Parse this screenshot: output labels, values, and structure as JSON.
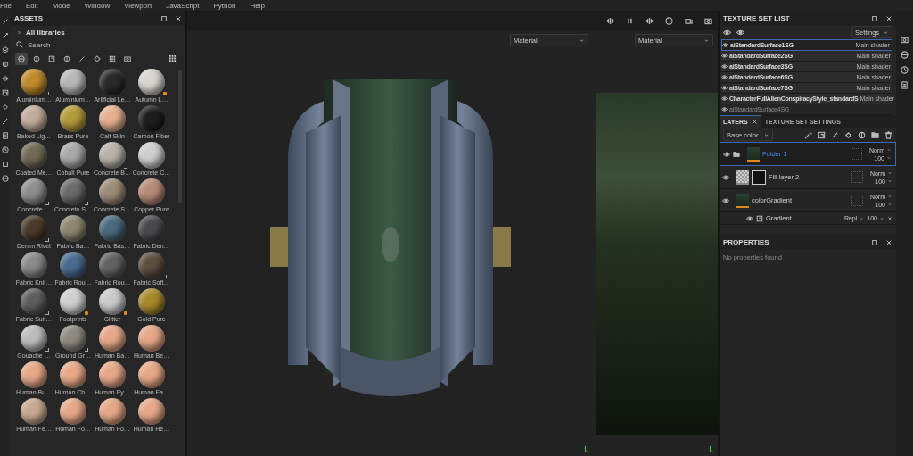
{
  "menu": [
    "File",
    "Edit",
    "Mode",
    "Window",
    "Viewport",
    "JavaScript",
    "Python",
    "Help"
  ],
  "assets": {
    "title": "ASSETS",
    "library": "All libraries",
    "search": {
      "placeholder": "Search"
    },
    "filters": [
      {
        "selected": true
      },
      {
        "selected": false
      },
      {
        "selected": false
      },
      {
        "selected": false
      },
      {
        "selected": false
      },
      {
        "selected": false
      },
      {
        "selected": false
      },
      {
        "selected": false
      }
    ],
    "materials": [
      {
        "name": "Aluminium…",
        "color": "#c08a2a",
        "kind": "procedural"
      },
      {
        "name": "Aluminium…",
        "color": "#b8b8b8",
        "kind": "basic"
      },
      {
        "name": "Artificial Le…",
        "color": "#2a2a2a",
        "kind": "basic"
      },
      {
        "name": "Autumn L…",
        "color": "#d8d4d0",
        "kind": "effect"
      },
      {
        "name": "Baked Lig…",
        "color": "#c2ad9a",
        "kind": "basic"
      },
      {
        "name": "Brass Pure",
        "color": "#b39a3a",
        "kind": "basic"
      },
      {
        "name": "Calf Skin",
        "color": "#e6b08f",
        "kind": "basic"
      },
      {
        "name": "Carbon Fiber",
        "color": "#1e1e1e",
        "kind": "basic"
      },
      {
        "name": "Coated Me…",
        "color": "#716a56",
        "kind": "basic"
      },
      {
        "name": "Cobalt Pure",
        "color": "#a8a8a8",
        "kind": "basic"
      },
      {
        "name": "Concrete B…",
        "color": "#b8b2a8",
        "kind": "procedural"
      },
      {
        "name": "Concrete C…",
        "color": "#cfcfcf",
        "kind": "basic"
      },
      {
        "name": "Concrete …",
        "color": "#8e8e8e",
        "kind": "procedural"
      },
      {
        "name": "Concrete S…",
        "color": "#6a6a6a",
        "kind": "procedural"
      },
      {
        "name": "Concrete S…",
        "color": "#9c8c78",
        "kind": "basic"
      },
      {
        "name": "Copper Pure",
        "color": "#b88a78",
        "kind": "basic"
      },
      {
        "name": "Denim Rivet",
        "color": "#4a3a2a",
        "kind": "procedural"
      },
      {
        "name": "Fabric Ba…",
        "color": "#8e8670",
        "kind": "basic"
      },
      {
        "name": "Fabric Bas…",
        "color": "#4a6a7e",
        "kind": "basic"
      },
      {
        "name": "Fabric Den…",
        "color": "#4a4a4e",
        "kind": "basic"
      },
      {
        "name": "Fabric Knit…",
        "color": "#8a8a8a",
        "kind": "basic"
      },
      {
        "name": "Fabric Rou…",
        "color": "#4a6a8e",
        "kind": "basic"
      },
      {
        "name": "Fabric Rou…",
        "color": "#626262",
        "kind": "basic"
      },
      {
        "name": "Fabric Soft…",
        "color": "#5e4e40",
        "kind": "procedural"
      },
      {
        "name": "Fabric Suit…",
        "color": "#5e5e5e",
        "kind": "procedural"
      },
      {
        "name": "Footprints",
        "color": "#d0d0d0",
        "kind": "effect"
      },
      {
        "name": "Glitter",
        "color": "#cacaca",
        "kind": "effect"
      },
      {
        "name": "Gold Pure",
        "color": "#a88a2a",
        "kind": "basic"
      },
      {
        "name": "Gouache …",
        "color": "#bcbcbc",
        "kind": "procedural"
      },
      {
        "name": "Ground Gr…",
        "color": "#8e8a80",
        "kind": "procedural"
      },
      {
        "name": "Human Ba…",
        "color": "#e6a888",
        "kind": "basic"
      },
      {
        "name": "Human Be…",
        "color": "#e6a888",
        "kind": "basic"
      },
      {
        "name": "Human Bu…",
        "color": "#e6a888",
        "kind": "basic"
      },
      {
        "name": "Human Ch…",
        "color": "#e6a888",
        "kind": "basic"
      },
      {
        "name": "Human Ey…",
        "color": "#e6a888",
        "kind": "basic"
      },
      {
        "name": "Human Fa…",
        "color": "#e6a888",
        "kind": "basic"
      },
      {
        "name": "Human Fe…",
        "color": "#c8a890",
        "kind": "basic"
      },
      {
        "name": "Human Fo…",
        "color": "#e6a888",
        "kind": "basic"
      },
      {
        "name": "Human Fo…",
        "color": "#e6a888",
        "kind": "basic"
      },
      {
        "name": "Human He…",
        "color": "#e6a888",
        "kind": "basic"
      }
    ]
  },
  "viewport": {
    "left_mode": "Material",
    "right_mode": "Material"
  },
  "texture_set_list": {
    "title": "TEXTURE SET LIST",
    "settings": "Settings",
    "sets": [
      {
        "name": "aiStandardSurface1SG",
        "shader": "Main shader",
        "selected": true,
        "disabled": false
      },
      {
        "name": "aiStandardSurface2SG",
        "shader": "Main shader",
        "selected": false,
        "disabled": false
      },
      {
        "name": "aiStandardSurface3SG",
        "shader": "Main shader",
        "selected": false,
        "disabled": false
      },
      {
        "name": "aiStandardSurface6SG",
        "shader": "Main shader",
        "selected": false,
        "disabled": false
      },
      {
        "name": "aiStandardSurface7SG",
        "shader": "Main shader",
        "selected": false,
        "disabled": false
      },
      {
        "name": "CharacterFullAlienConspiracyStyle_standardS",
        "shader": "Main shader",
        "selected": false,
        "disabled": false
      },
      {
        "name": "aiStandardSurface4SG",
        "selected": false,
        "disabled": true
      }
    ]
  },
  "layers": {
    "tabs": [
      {
        "label": "LAYERS",
        "selected": true,
        "closable": true
      },
      {
        "label": "TEXTURE SET SETTINGS",
        "selected": false,
        "closable": false
      }
    ],
    "channel": "Base color",
    "items": [
      {
        "kind": "folder",
        "name": "Folder 1",
        "blend": "Norm",
        "opacity": "100",
        "selected": true
      },
      {
        "kind": "fill",
        "name": "Fill layer 2",
        "blend": "Norm",
        "opacity": "100",
        "selected": false
      },
      {
        "kind": "paint",
        "name": "colorGradient",
        "blend": "Norm",
        "opacity": "100",
        "selected": false
      },
      {
        "kind": "effect",
        "name": "Gradient",
        "blend": "Repl",
        "opacity": "100",
        "selected": false
      }
    ]
  },
  "properties": {
    "title": "PROPERTIES",
    "message": "No properties found"
  }
}
